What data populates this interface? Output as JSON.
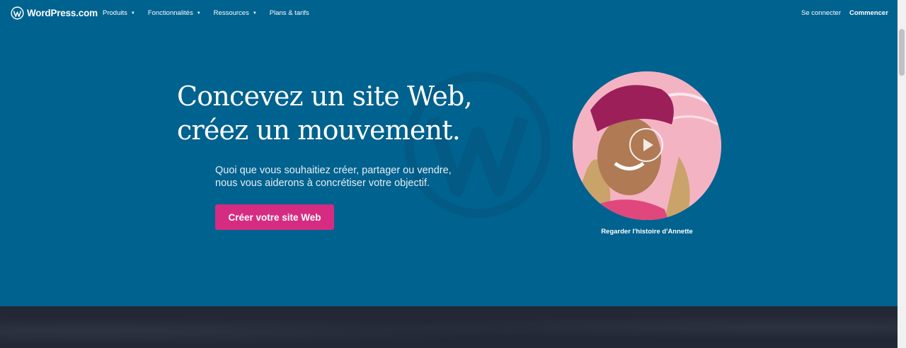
{
  "brand": {
    "name": "WordPress.com"
  },
  "nav": {
    "items": [
      {
        "label": "Produits",
        "has_dropdown": true
      },
      {
        "label": "Fonctionnalités",
        "has_dropdown": true
      },
      {
        "label": "Ressources",
        "has_dropdown": true
      },
      {
        "label": "Plans & tarifs",
        "has_dropdown": false
      }
    ],
    "login": "Se connecter",
    "start": "Commencer"
  },
  "hero": {
    "headline_line1": "Concevez un site Web,",
    "headline_line2": "créez un mouvement.",
    "sub_line1": "Quoi que vous souhaitiez créer, partager ou vendre,",
    "sub_line2": "nous vous aiderons à concrétiser votre objectif.",
    "cta": "Créer votre site Web",
    "video_caption": "Regarder l'histoire d'Annette"
  },
  "colors": {
    "hero_bg": "#00628f",
    "cta_bg": "#d52c82",
    "dark_section": "#232836"
  },
  "icons": {
    "logo": "wordpress-logo-icon",
    "dropdown": "caret-down-icon",
    "play": "play-icon"
  }
}
